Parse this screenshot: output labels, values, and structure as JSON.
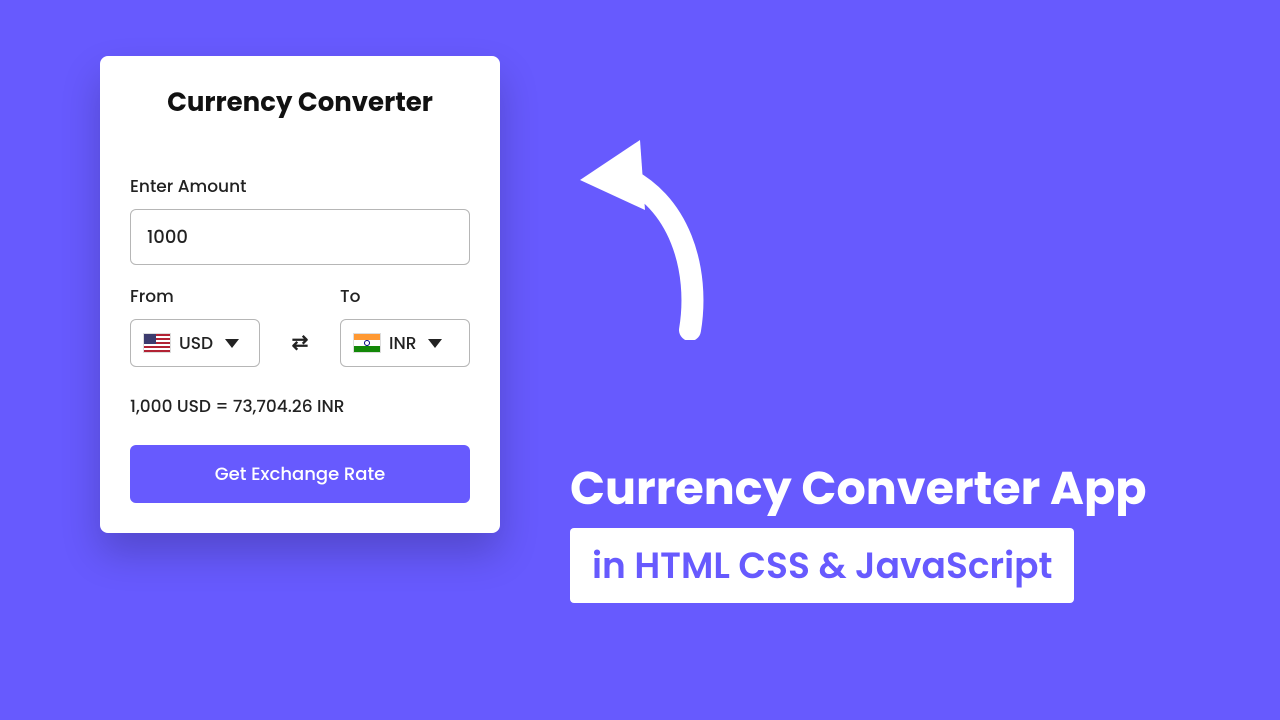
{
  "card": {
    "title": "Currency Converter",
    "amount_label": "Enter Amount",
    "amount_value": "1000",
    "from_label": "From",
    "to_label": "To",
    "from_currency": "USD",
    "to_currency": "INR",
    "result": "1,000 USD = 73,704.26 INR",
    "button_label": "Get Exchange Rate"
  },
  "hero": {
    "title": "Currency Converter App",
    "subtitle": "in HTML CSS & JavaScript"
  },
  "icons": {
    "swap": "⇄",
    "from_flag": "us",
    "to_flag": "in"
  }
}
